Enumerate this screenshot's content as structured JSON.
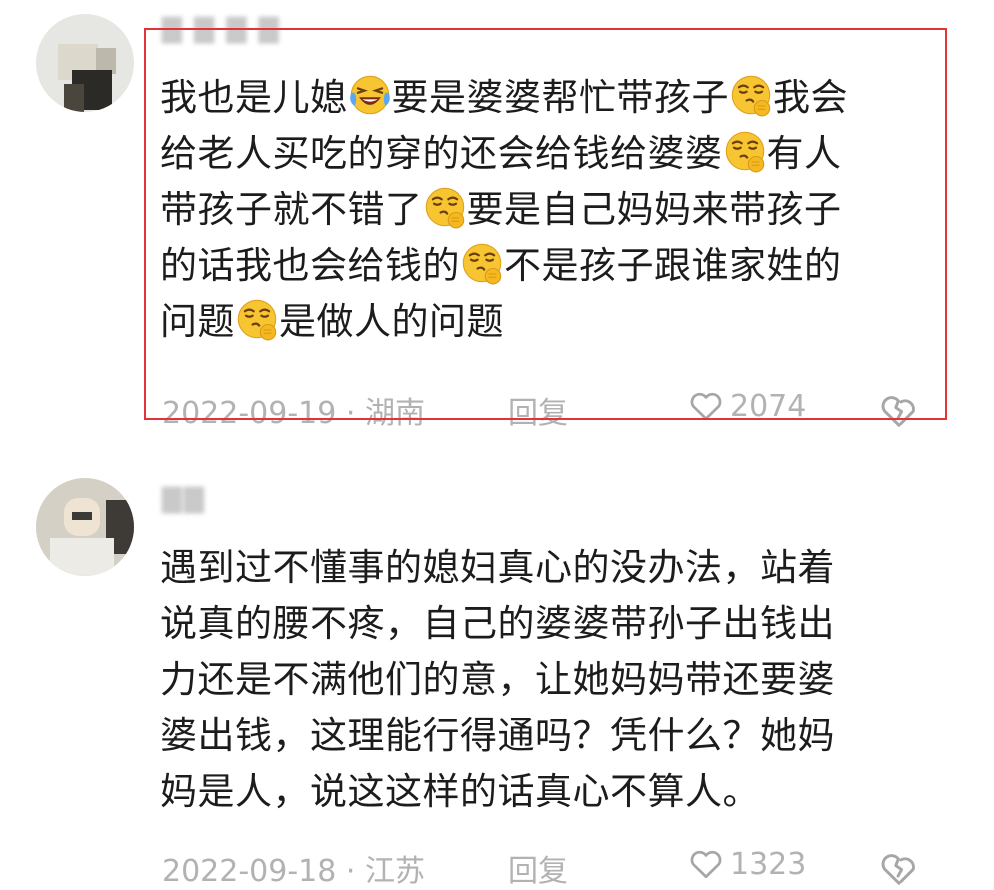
{
  "comments": [
    {
      "username": "▇ ▇ ▇ ▇",
      "lines": [
        [
          "我也是儿媳",
          "laughing-crying-emoji",
          "要是婆婆帮忙带孩子",
          "smirking-hand-emoji",
          "我会"
        ],
        [
          "给老人买吃的穿的还会给钱给婆婆",
          "smirking-hand-emoji",
          "有人"
        ],
        [
          "带孩子就不错了",
          "smirking-hand-emoji",
          "要是自己妈妈来带孩子"
        ],
        [
          "的话我也会给钱的",
          "smirking-hand-emoji",
          "不是孩子跟谁家姓的"
        ],
        [
          "问题",
          "smirking-hand-emoji",
          "是做人的问题"
        ]
      ],
      "date_location": "2022-09-19 · 湖南",
      "reply_label": "回复",
      "likes": "2074",
      "highlighted": true
    },
    {
      "username": "▇▇",
      "lines": [
        [
          "遇到过不懂事的媳妇真心的没办法，站着"
        ],
        [
          "说真的腰不疼，自己的婆婆带孙子出钱出"
        ],
        [
          "力还是不满他们的意，让她妈妈带还要婆"
        ],
        [
          "婆出钱，这理能行得通吗？凭什么？她妈"
        ],
        [
          "妈是人，说这这样的话真心不算人。"
        ]
      ],
      "date_location": "2022-09-18 · 江苏",
      "reply_label": "回复",
      "likes": "1323",
      "highlighted": false
    }
  ],
  "colors": {
    "highlight_border": "#e3333a",
    "text": "#1c1c1c",
    "meta": "#b2b2b2",
    "emoji_face": "#f7c531"
  },
  "icons": [
    "heart-icon",
    "broken-heart-icon",
    "laughing-crying-emoji",
    "smirking-hand-emoji"
  ]
}
